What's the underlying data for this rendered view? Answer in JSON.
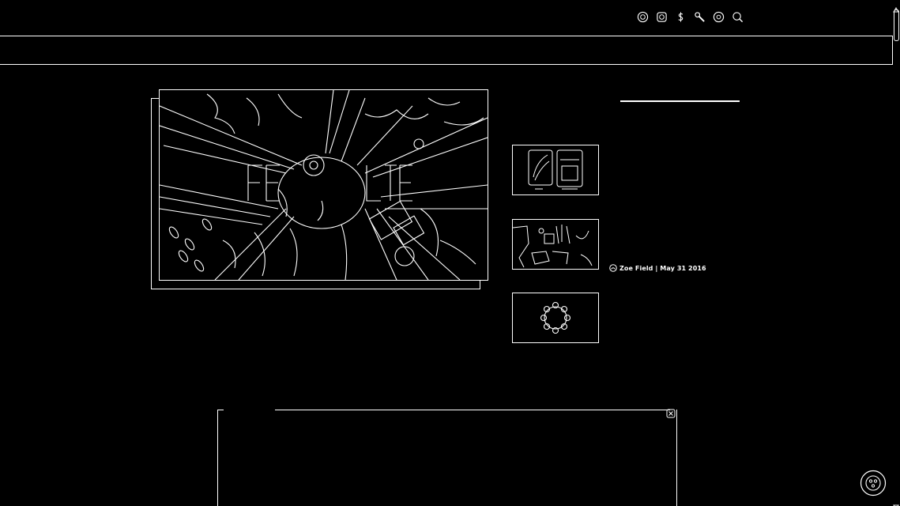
{
  "toolbar": {
    "icons": [
      "globe-icon",
      "instagram-icon",
      "dollar-icon",
      "wrench-icon",
      "target-icon",
      "search-icon"
    ]
  },
  "hero": {
    "icon": "artwork-image",
    "title_text": "FE UTE"
  },
  "thumbnails": [
    {
      "icon": "cards-image"
    },
    {
      "icon": "scene-image"
    },
    {
      "icon": "ring-image"
    }
  ],
  "meta": {
    "avatar_icon": "avatar-icon",
    "text": "Zoe Field | May 31 2016"
  },
  "panel": {
    "close_icon": "close-icon"
  },
  "fab": {
    "icon": "chat-icon"
  }
}
